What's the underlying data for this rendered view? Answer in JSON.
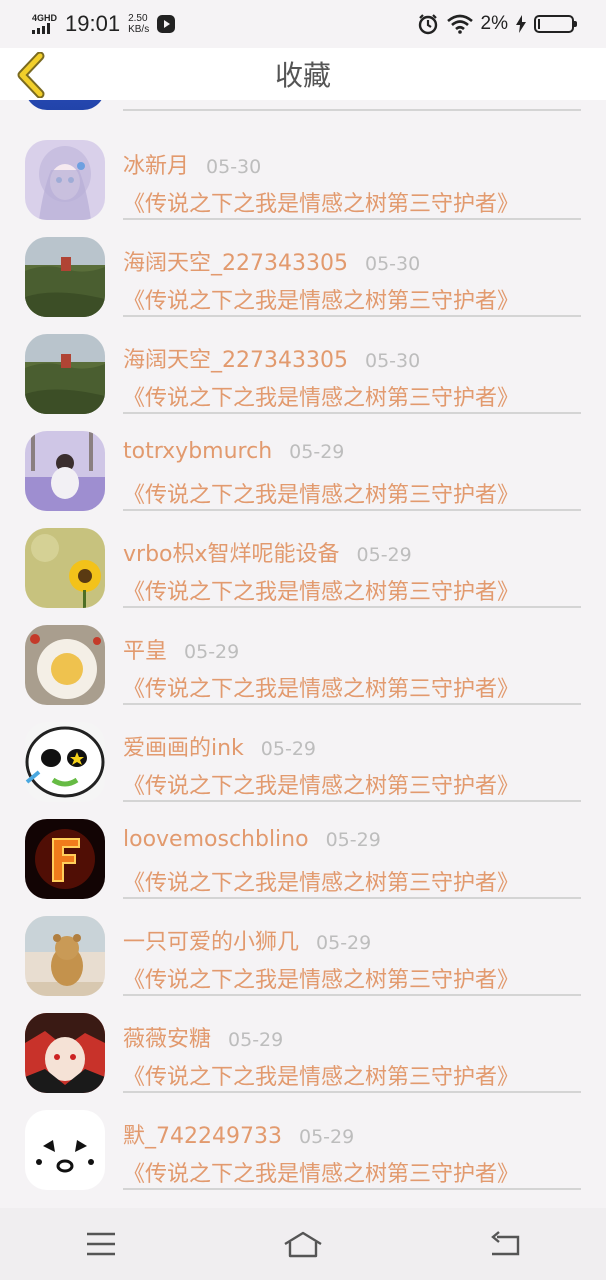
{
  "status_bar": {
    "network": "4GHD",
    "time": "19:01",
    "speed_value": "2.50",
    "speed_unit": "KB/s",
    "battery": "2%",
    "battery_level": 0.02
  },
  "header": {
    "title": "收藏"
  },
  "list": [
    {
      "name": "冰新月",
      "date": "05-30",
      "book": "《传说之下之我是情感之树第三守护者》",
      "avatar": "anime-girl-avatar"
    },
    {
      "name": "海阔天空_227343305",
      "date": "05-30",
      "book": "《传说之下之我是情感之树第三守护者》",
      "avatar": "landscape-avatar"
    },
    {
      "name": "海阔天空_227343305",
      "date": "05-30",
      "book": "《传说之下之我是情感之树第三守护者》",
      "avatar": "landscape-avatar"
    },
    {
      "name": "totrxybmurch",
      "date": "05-29",
      "book": "《传说之下之我是情感之树第三守护者》",
      "avatar": "lavender-girl-avatar"
    },
    {
      "name": "vrbo枳x智烊呢能设备",
      "date": "05-29",
      "book": "《传说之下之我是情感之树第三守护者》",
      "avatar": "sunflower-avatar"
    },
    {
      "name": "平皇",
      "date": "05-29",
      "book": "《传说之下之我是情感之树第三守护者》",
      "avatar": "food-plate-avatar"
    },
    {
      "name": "爱画画的ink",
      "date": "05-29",
      "book": "《传说之下之我是情感之树第三守护者》",
      "avatar": "cartoon-skull-avatar"
    },
    {
      "name": "loovemoschblino",
      "date": "05-29",
      "book": "《传说之下之我是情感之树第三守护者》",
      "avatar": "fire-letter-avatar"
    },
    {
      "name": "一只可爱的小狮几",
      "date": "05-29",
      "book": "《传说之下之我是情感之树第三守护者》",
      "avatar": "lion-cub-avatar"
    },
    {
      "name": "薇薇安糖",
      "date": "05-29",
      "book": "《传说之下之我是情感之树第三守护者》",
      "avatar": "red-anime-avatar"
    },
    {
      "name": "默_742249733",
      "date": "05-29",
      "book": "《传说之下之我是情感之树第三守护者》",
      "avatar": "white-face-avatar"
    }
  ]
}
